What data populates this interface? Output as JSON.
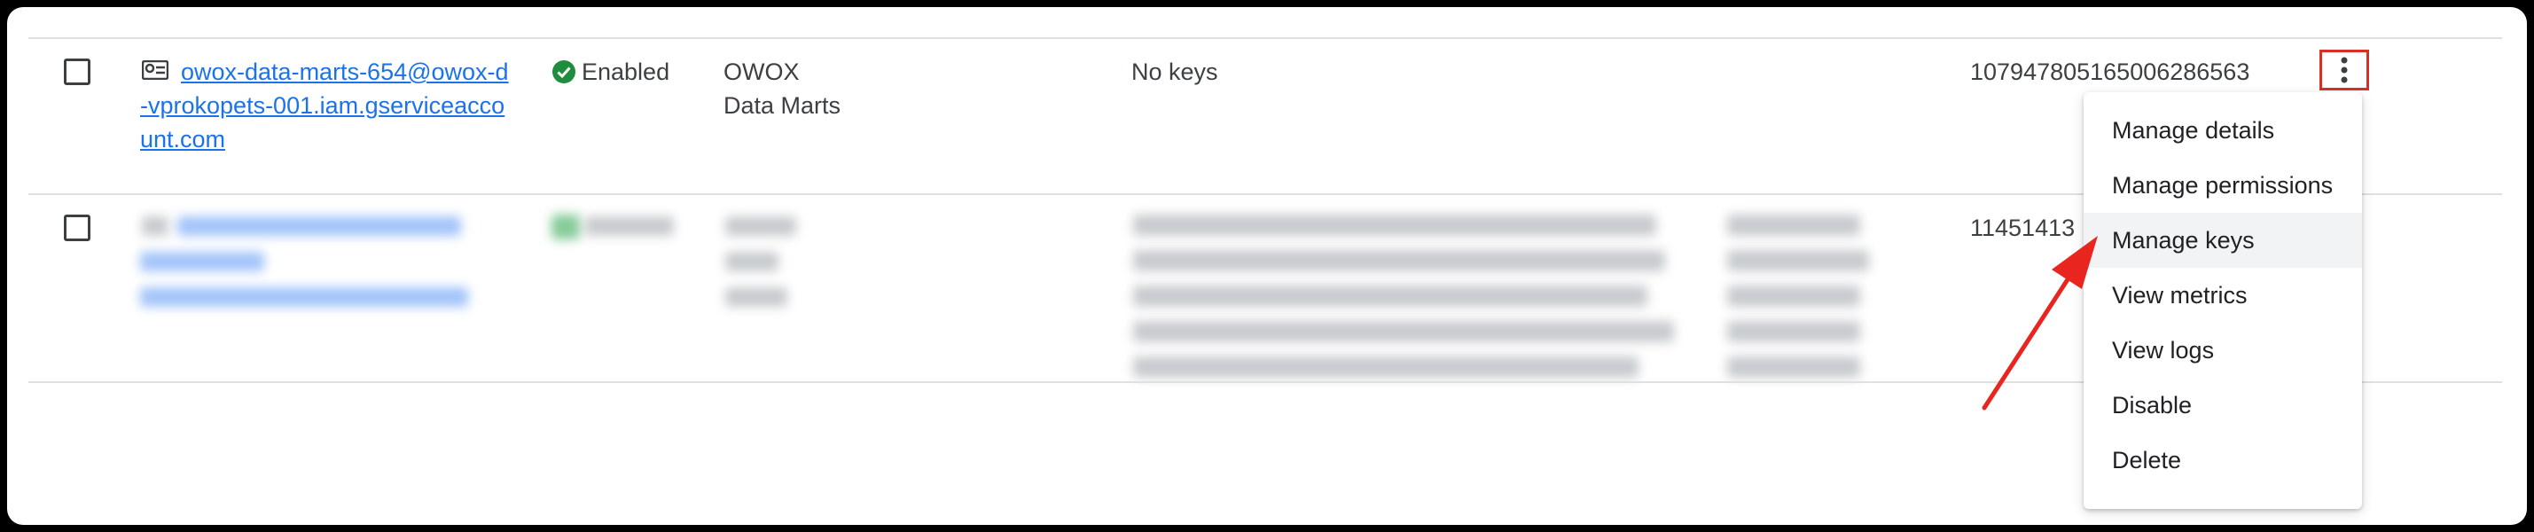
{
  "rows": [
    {
      "email": "owox-data-marts-654@owox-d-vprokopets-001.iam.gserviceaccount.com",
      "status": "Enabled",
      "display_name": "OWOX Data Marts",
      "keys": "No keys",
      "unique_id": "107947805165006286563"
    },
    {
      "unique_id_partial": "11451413"
    }
  ],
  "menu": {
    "items": [
      "Manage details",
      "Manage permissions",
      "Manage keys",
      "View metrics",
      "View logs",
      "Disable",
      "Delete"
    ],
    "hovered": "Manage keys"
  },
  "colors": {
    "link": "#1a73e8",
    "enabled": "#1e8e3e",
    "highlight": "#d93025",
    "text": "#3c4043"
  },
  "icons": {
    "service_account": "service-account-icon",
    "status": "check-circle-icon",
    "more": "more-vert-icon"
  }
}
